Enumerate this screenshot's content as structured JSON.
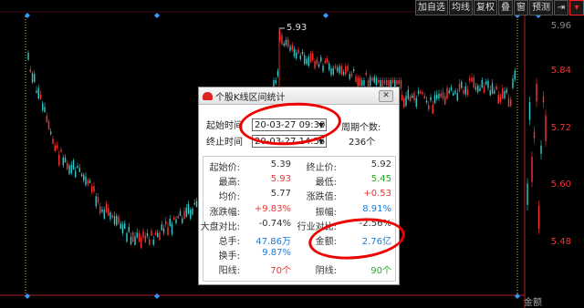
{
  "toolbar": {
    "buttons": [
      "加自选",
      "均线",
      "复权",
      "叠",
      "窗",
      "预测"
    ],
    "pin_icon": "pin-icon",
    "dropdown_icon": "chevron-down-icon"
  },
  "chart": {
    "peak_label": "5.93",
    "price_labels": [
      "5.96",
      "5.84",
      "5.72",
      "5.60",
      "5.48"
    ],
    "bottom_label": "金额",
    "up_color": "#ff3333",
    "down_color": "#33cccc",
    "background": "#000000"
  },
  "dialog": {
    "title": "个股K线区间统计",
    "close_icon": "close-icon",
    "start_label": "起始时间",
    "start_value": "20-03-27 09:30",
    "end_label": "终止时间",
    "end_value": "20-03-27 14:55",
    "period_label": "周期个数:",
    "period_value": "236个",
    "stats": [
      {
        "l_label": "起始价:",
        "l_value": "5.39",
        "l_color": "dark",
        "r_label": "终止价:",
        "r_value": "5.92",
        "r_color": "dark"
      },
      {
        "l_label": "最高:",
        "l_value": "5.93",
        "l_color": "red",
        "r_label": "最低:",
        "r_value": "5.45",
        "r_color": "green"
      },
      {
        "l_label": "均价:",
        "l_value": "5.77",
        "l_color": "dark",
        "r_label": "涨跌值:",
        "r_value": "+0.53",
        "r_color": "red"
      },
      {
        "l_label": "涨跌幅:",
        "l_value": "+9.83%",
        "l_color": "red",
        "r_label": "振幅:",
        "r_value": "8.91%",
        "r_color": "blue"
      },
      {
        "l_label": "大盘对比:",
        "l_value": "-0.74%",
        "l_color": "dark",
        "r_label": "行业对比:",
        "r_value": "-2.56%",
        "r_color": "dark"
      },
      {
        "l_label": "总手:",
        "l_value": "47.86万",
        "l_color": "blue",
        "r_label": "金额:",
        "r_value": "2.76亿",
        "r_color": "blue"
      },
      {
        "l_label": "换手:",
        "l_value": "9.87%",
        "l_color": "blue",
        "r_label": "",
        "r_value": "",
        "r_color": "dark"
      },
      {
        "l_label": "阳线:",
        "l_value": "70个",
        "l_color": "red",
        "r_label": "阴线:",
        "r_value": "90个",
        "r_color": "green"
      }
    ]
  }
}
